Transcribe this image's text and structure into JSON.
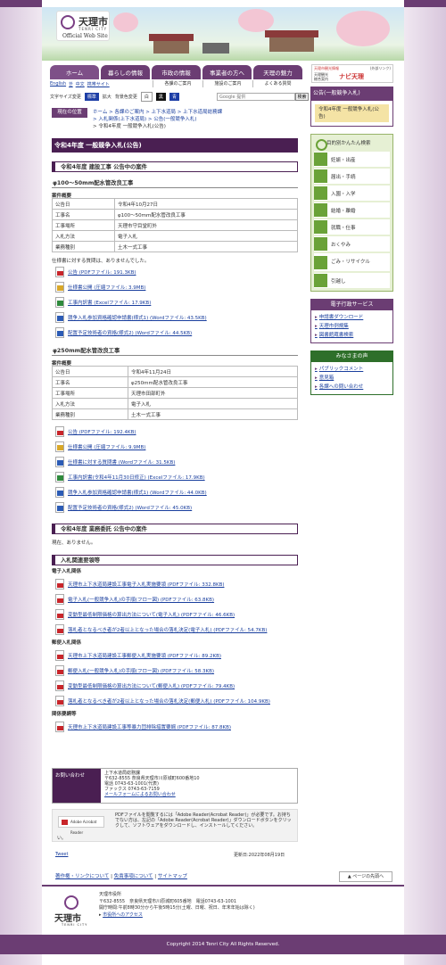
{
  "header": {
    "logo_title": "天理市",
    "logo_romaji": "TENRI CITY",
    "logo_sub": "Official Web Site"
  },
  "nav": {
    "tabs": [
      "ホーム",
      "暮らしの情報",
      "市政の情報",
      "事業者の方へ",
      "天理の魅力"
    ]
  },
  "subnav": {
    "lang_en": "English",
    "lang_ko": "한",
    "lang_zh": "中文",
    "mobile": "携帯サイト",
    "items": [
      "各課のご案内",
      "施設のご案内",
      "よくある質問"
    ]
  },
  "tools": {
    "font_size_label": "文字サイズ変更",
    "font_std": "標準",
    "font_big": "拡大",
    "bg_label": "背景色変更",
    "bg_white": "白",
    "bg_black": "黒",
    "bg_blue": "青",
    "search_placeholder": "Google 提供",
    "search_button": "検索"
  },
  "ext": {
    "label": "天理市観光情報",
    "external": "(外部リンク)",
    "navi_lines": [
      "天理観光",
      "総合案内"
    ],
    "navi_logo": "ナビ天理"
  },
  "breadcrumb": {
    "here": "現在の位置",
    "lines": [
      "ホーム > 各課のご案内 > 上下水道局 > 上下水道局総務課",
      "> 入札関係(上下水道局) > 公告(一般競争入札)",
      "> 令和4年度 一般競争入札(公告)"
    ]
  },
  "main": {
    "title": "令和4年度 一般競争入札(公告)",
    "sec1": "令和4年度 建設工事 公告中の案件",
    "p1": {
      "name": "φ100～50mm配水管改良工事",
      "label": "案件概要",
      "rows": [
        [
          "公告日",
          "令和4年10月27日"
        ],
        [
          "工事名",
          "φ100～50mm配水管改良工事"
        ],
        [
          "工事場所",
          "天理市守目堂町外"
        ],
        [
          "入札方法",
          "電子入札"
        ],
        [
          "業務種別",
          "土木一式工事"
        ]
      ],
      "note": "仕様書に対する質問は、ありませんでした。",
      "files": [
        [
          "pdf",
          "公告 (PDFファイル: 191.3KB)"
        ],
        [
          "zip",
          "仕様書公開 (圧縮ファイル: 3.9MB)"
        ],
        [
          "xls",
          "工事内訳書 (Excelファイル: 17.9KB)"
        ],
        [
          "doc",
          "競争入札参加資格確認申請書(様式1) (Wordファイル: 43.5KB)"
        ],
        [
          "doc",
          "配置予定技術者の資格(様式2) (Wordファイル: 44.5KB)"
        ]
      ]
    },
    "p2": {
      "name": "φ250mm配水管改良工事",
      "label": "案件概要",
      "rows": [
        [
          "公告日",
          "令和4年11月24日"
        ],
        [
          "工事名",
          "φ250mm配水管改良工事"
        ],
        [
          "工事場所",
          "天理市田部町外"
        ],
        [
          "入札方法",
          "電子入札"
        ],
        [
          "業務種別",
          "土木一式工事"
        ]
      ],
      "files": [
        [
          "pdf",
          "公告 (PDFファイル: 192.4KB)"
        ],
        [
          "zip",
          "仕様書公開 (圧縮ファイル: 9.9MB)"
        ],
        [
          "doc",
          "仕様書に対する質問書 (Wordファイル: 31.5KB)"
        ],
        [
          "xls",
          "工事内訳書(令和4年11月30日修正) (Excelファイル: 17.9KB)"
        ],
        [
          "doc",
          "競争入札参加資格確認申請書(様式1) (Wordファイル: 44.0KB)"
        ],
        [
          "doc",
          "配置予定技術者の資格(様式2) (Wordファイル: 45.0KB)"
        ]
      ]
    },
    "sec2": "令和4年度 業務委託 公告中の案件",
    "none": "現在、ありません。",
    "sec3": "入札関連要領等",
    "g1": "電子入札関係",
    "g1_files": [
      "天理市上下水道局建設工事電子入札実施要領 (PDFファイル: 332.8KB)",
      "電子入札(一般競争入札)の手順(フロー図) (PDFファイル: 63.8KB)",
      "変動型最低制限価格の算出方法について(電子入札) (PDFファイル: 46.6KB)",
      "落札者となるべき者が2者以上となった場合の落札決定(電子入札) (PDFファイル: 54.7KB)"
    ],
    "g2": "郵便入札関係",
    "g2_files": [
      "天理市上下水道局建設工事郵便入札実施要領 (PDFファイル: 89.2KB)",
      "郵便入札(一般競争入札)の手順(フロー図) (PDFファイル: 58.3KB)",
      "変動型最低制限価格の算出方法について(郵便入札) (PDFファイル: 79.4KB)",
      "落札者となるべき者が2者以上となった場合の落札決定(郵便入札) (PDFファイル: 104.9KB)"
    ],
    "g3": "関係要綱等",
    "g3_files": [
      "天理市上下水道局建設工事等暴力団排除措置要綱 (PDFファイル: 87.8KB)"
    ]
  },
  "contact": {
    "head": "お問い合わせ",
    "lines": [
      "上下水道局総務課",
      "〒632-8555 奈良県天理市川原城町600番地10",
      "電話 0743-63-1001(代表)",
      "ファックス 0743-63-7159"
    ],
    "mail": "メールフォームによるお問い合わせ"
  },
  "reader": {
    "btn": "Adobe Acrobat Reader",
    "text": "PDFファイルを閲覧するには「Adobe Reader(Acrobat Reader)」が必要です。お持ちでない方は、左記の「Adobe Reader(Acrobat Reader)」ダウンロードボタンをクリックして、ソフトウェアをダウンロードし、インストールしてください。",
    "tail": "い。"
  },
  "tweet": "Tweet",
  "updated": "更新日:2022年08月19日",
  "footlinks": [
    "著作権・リンクについて",
    "免責事項について",
    "サイトマップ"
  ],
  "pagetop": "ページの先頭へ",
  "footer": {
    "name": "天理市",
    "romaji": "TENRI CITY",
    "lines": [
      "天理市役所",
      "〒632-8555　奈良県天理市川原城町605番地　電話0743-63-1001",
      "開庁時間:午前8時30分から午後5時15分(土曜、日曜、祝日、年末年始は除く)"
    ],
    "access": "市役所へのアクセス"
  },
  "copyright": "Copyright 2014 Tenri City All Rights Reserved.",
  "side": {
    "head": "公告(一般競争入札)",
    "current": "令和4年度 一般競争入札(公告)",
    "guide_title": "目的別かんたん検索",
    "guide": [
      "妊娠・出産",
      "届出・手続",
      "入園・入学",
      "結婚・離婚",
      "就職・仕事",
      "おくやみ",
      "ごみ・リサイクル",
      "引越し"
    ],
    "e_head": "電子行政サービス",
    "e_links": [
      "申請書ダウンロード",
      "天理市例規集",
      "図書館蔵書検索"
    ],
    "v_head": "みなさまの声",
    "v_links": [
      "パブリックコメント",
      "意見箱",
      "各課への問い合わせ"
    ]
  }
}
